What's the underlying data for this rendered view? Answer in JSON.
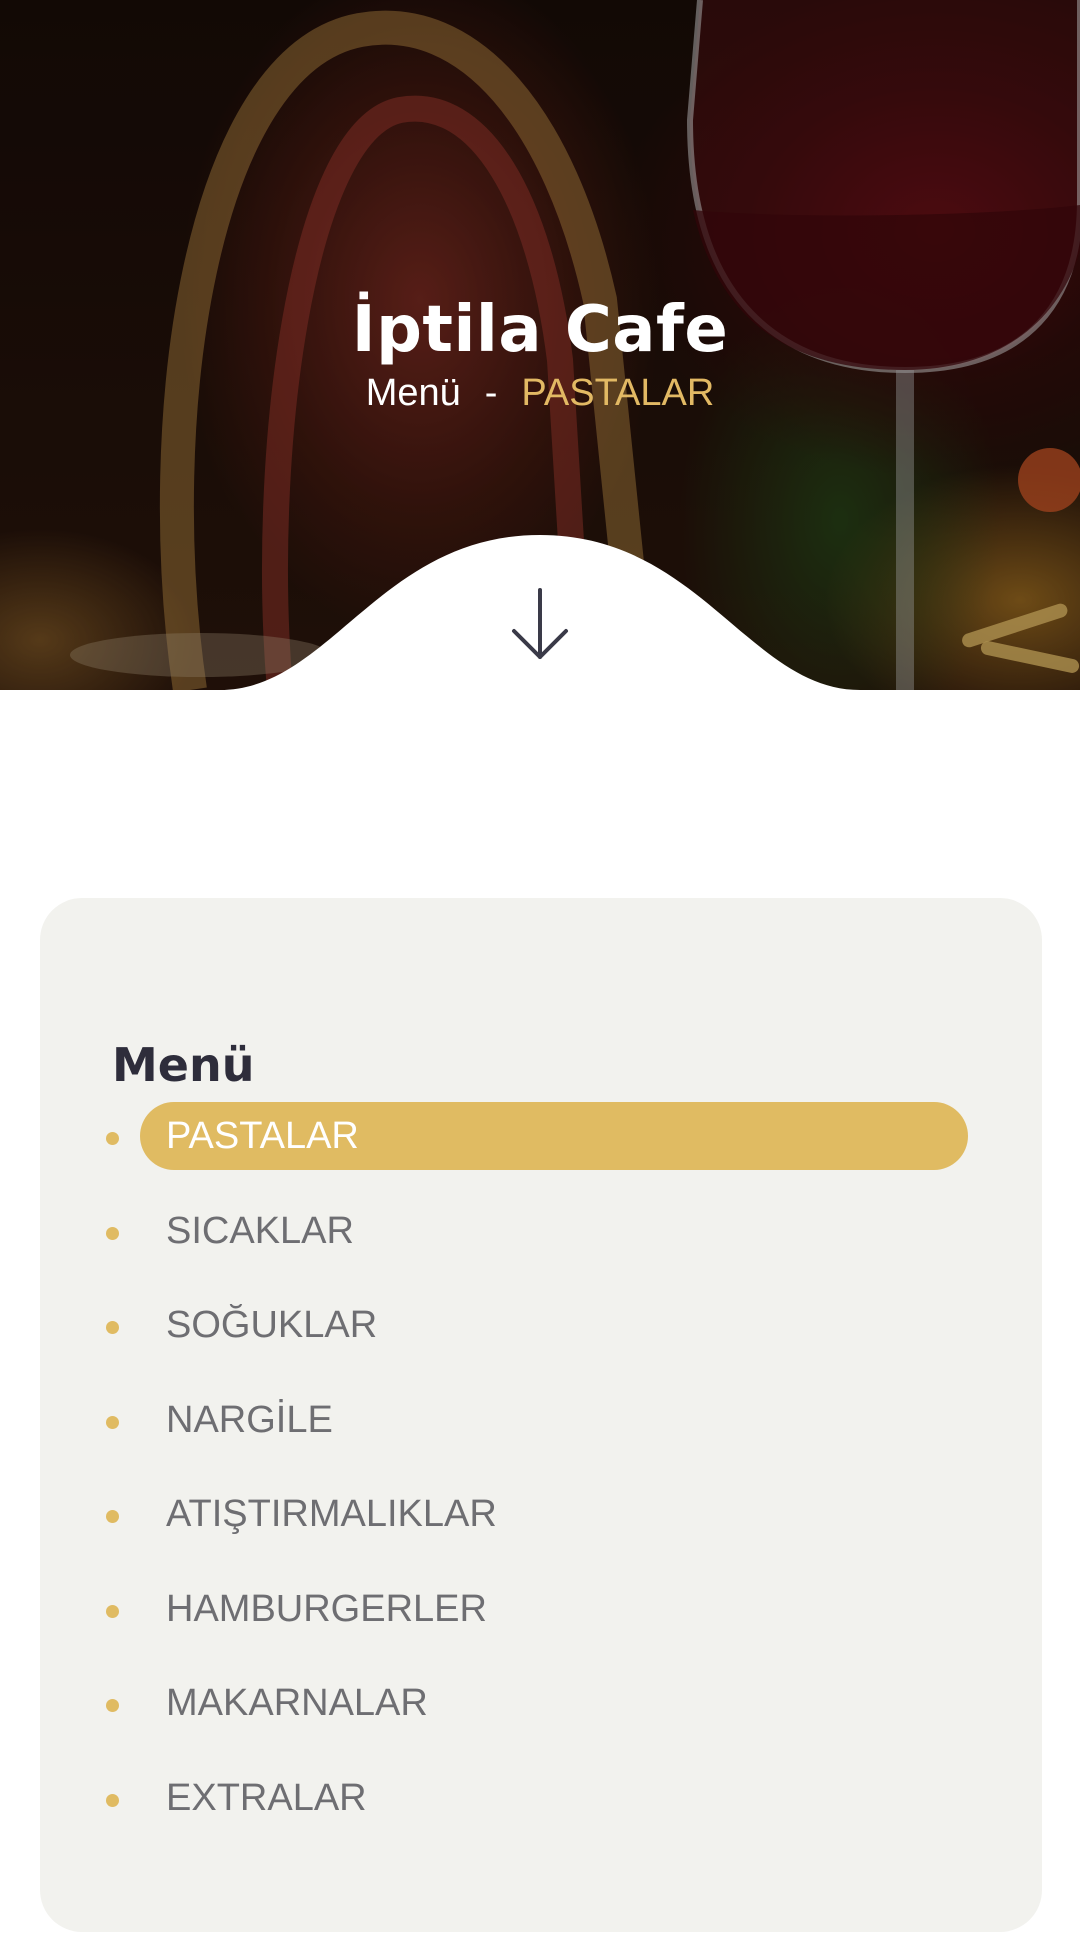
{
  "hero": {
    "title": "İptila Cafe",
    "breadcrumb": {
      "root": "Menü",
      "separator": "-",
      "current": "PASTALAR"
    },
    "scroll_icon": "arrow-down-icon"
  },
  "menu": {
    "heading": "Menü",
    "items": [
      {
        "label": "PASTALAR",
        "active": true
      },
      {
        "label": "SICAKLAR",
        "active": false
      },
      {
        "label": "SOĞUKLAR",
        "active": false
      },
      {
        "label": "NARGİLE",
        "active": false
      },
      {
        "label": "ATIŞTIRMALIKLAR",
        "active": false
      },
      {
        "label": "HAMBURGERLER",
        "active": false
      },
      {
        "label": "MAKARNALAR",
        "active": false
      },
      {
        "label": "EXTRALAR",
        "active": false
      }
    ]
  },
  "colors": {
    "accent": "#e0bb62",
    "heading": "#2e2d3b",
    "item_text": "#6e6e72",
    "card_bg": "#f2f2ee"
  }
}
